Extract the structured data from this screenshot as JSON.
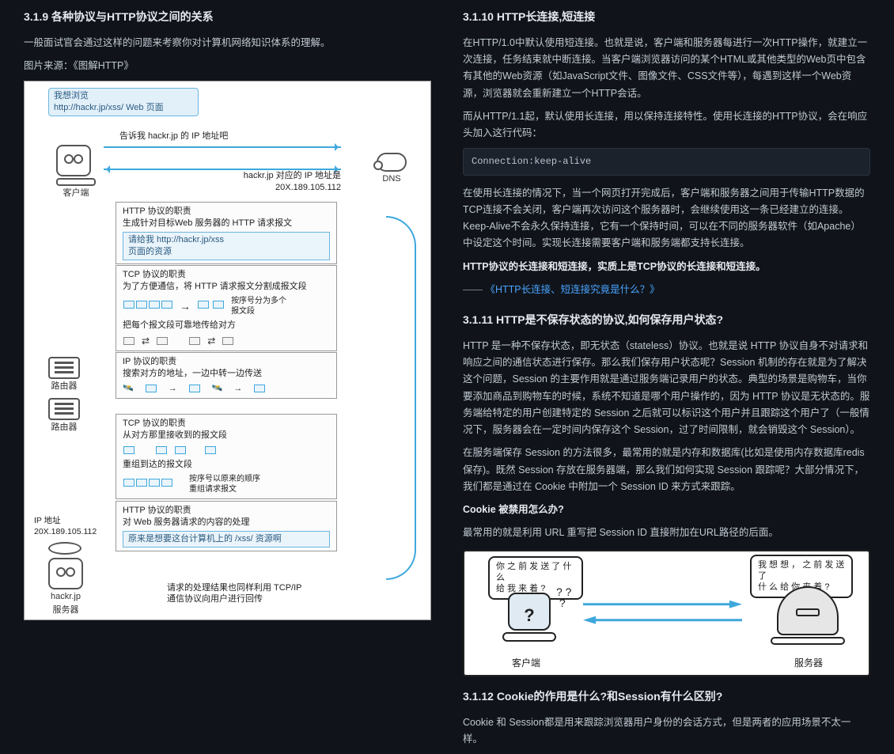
{
  "left": {
    "h319": "3.1.9 各种协议与HTTP协议之间的关系",
    "p1": "一般面试官会通过这样的问题来考察你对计算机网络知识体系的理解。",
    "p2": "图片来源：《图解HTTP》",
    "diagram": {
      "bubble1a": "我想浏览",
      "bubble1b": "http://hackr.jp/xss/ Web 页面",
      "ask_dns": "告诉我 hackr.jp 的 IP 地址吧",
      "dns_reply1": "hackr.jp 对应的 IP 地址是",
      "dns_reply2": "20X.189.105.112",
      "client_label": "客户端",
      "dns_label": "DNS",
      "http_box_title": "HTTP 协议的职责",
      "http_box_line": "生成针对目标Web 服务器的 HTTP 请求报文",
      "http_inner1": "请给我 http://hackr.jp/xss",
      "http_inner2": "页面的资源",
      "tcp1_title": "TCP 协议的职责",
      "tcp1_line": "为了方便通信，将 HTTP 请求报文分割成报文段",
      "tcp1_note1": "按序号分为多个",
      "tcp1_note2": "报文段",
      "tcp1_note3": "把每个报文段可靠地传给对方",
      "ip_title": "IP 协议的职责",
      "ip_line": "搜索对方的地址，一边中转一边传送",
      "router_label": "路由器",
      "tcp2_title": "TCP 协议的职责",
      "tcp2_line": "从对方那里接收到的报文段",
      "tcp2_note1": "重组到达的报文段",
      "tcp2_note2": "按序号以原来的顺序",
      "tcp2_note3": "重组请求报文",
      "http2_title": "HTTP 协议的职责",
      "http2_line": "对 Web 服务器请求的内容的处理",
      "http2_inner": "原来是想要这台计算机上的 /xss/ 资源啊",
      "ip_label1": "IP 地址",
      "ip_label2": "20X.189.105.112",
      "server_label1": "hackr.jp",
      "server_label2": "服务器",
      "footer1": "请求的处理结果也同样利用 TCP/IP",
      "footer2": "通信协议向用户进行回传"
    }
  },
  "right": {
    "h3110": "3.1.10 HTTP长连接,短连接",
    "p3": "在HTTP/1.0中默认使用短连接。也就是说，客户端和服务器每进行一次HTTP操作，就建立一次连接，任务结束就中断连接。当客户端浏览器访问的某个HTML或其他类型的Web页中包含有其他的Web资源（如JavaScript文件、图像文件、CSS文件等），每遇到这样一个Web资源，浏览器就会重新建立一个HTTP会话。",
    "p4": "而从HTTP/1.1起，默认使用长连接，用以保持连接特性。使用长连接的HTTP协议，会在响应头加入这行代码：",
    "code1": "Connection:keep-alive",
    "p5": "在使用长连接的情况下，当一个网页打开完成后，客户端和服务器之间用于传输HTTP数据的TCP连接不会关闭，客户端再次访问这个服务器时，会继续使用这一条已经建立的连接。Keep-Alive不会永久保持连接，它有一个保持时间，可以在不同的服务器软件（如Apache）中设定这个时间。实现长连接需要客户端和服务端都支持长连接。",
    "p6": "HTTP协议的长连接和短连接，实质上是TCP协议的长连接和短连接。",
    "dash": "—— ",
    "link1": "《HTTP长连接、短连接究竟是什么？》",
    "h3111": "3.1.11 HTTP是不保存状态的协议,如何保存用户状态?",
    "p7": "HTTP 是一种不保存状态，即无状态（stateless）协议。也就是说 HTTP 协议自身不对请求和响应之间的通信状态进行保存。那么我们保存用户状态呢？Session 机制的存在就是为了解决这个问题，Session 的主要作用就是通过服务端记录用户的状态。典型的场景是购物车，当你要添加商品到购物车的时候，系统不知道是哪个用户操作的，因为 HTTP 协议是无状态的。服务端给特定的用户创建特定的 Session 之后就可以标识这个用户并且跟踪这个用户了（一般情况下，服务器会在一定时间内保存这个 Session，过了时间限制，就会销毁这个 Session）。",
    "p8": "在服务端保存 Session 的方法很多，最常用的就是内存和数据库(比如是使用内存数据库redis保存)。既然 Session 存放在服务器端，那么我们如何实现 Session 跟踪呢？大部分情况下，我们都是通过在 Cookie 中附加一个 Session ID 来方式来跟踪。",
    "p9": "Cookie 被禁用怎么办?",
    "p10": "最常用的就是利用 URL 重写把 Session ID 直接附加在URL路径的后面。",
    "comic": {
      "left_bubble": "你 之 前 发 送 了 什 么\n给 我 来 着 ?",
      "right_bubble": "我 想 想 ， 之 前 发 送 了\n什 么 给 你 来 着 ?",
      "client": "客户端",
      "server": "服务器"
    },
    "h3112": "3.1.12 Cookie的作用是什么?和Session有什么区别?",
    "p11": "Cookie 和 Session都是用来跟踪浏览器用户身份的会话方式，但是两者的应用场景不太一样。"
  }
}
